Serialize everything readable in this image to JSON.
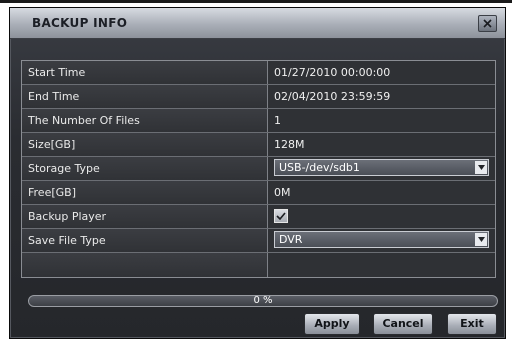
{
  "dialog": {
    "title": "BACKUP INFO",
    "close_icon": "close-icon"
  },
  "rows": [
    {
      "label": "Start Time",
      "value": "01/27/2010 00:00:00"
    },
    {
      "label": "End Time",
      "value": "02/04/2010 23:59:59"
    },
    {
      "label": "The Number Of Files",
      "value": "1"
    },
    {
      "label": "Size[GB]",
      "value": "128M"
    },
    {
      "label": "Storage Type",
      "value": "USB-/dev/sdb1"
    },
    {
      "label": "Free[GB]",
      "value": "0M"
    },
    {
      "label": "Backup Player",
      "checked": true
    },
    {
      "label": "Save File Type",
      "value": "DVR"
    }
  ],
  "progress": {
    "percent": 0,
    "label": "0 %"
  },
  "buttons": {
    "apply": "Apply",
    "cancel": "Cancel",
    "exit": "Exit"
  },
  "colors": {
    "dialog_bg": "#2a2c31",
    "title_bar": "#a9aeb7",
    "text": "#eaeaea",
    "border": "#8a8d93"
  }
}
